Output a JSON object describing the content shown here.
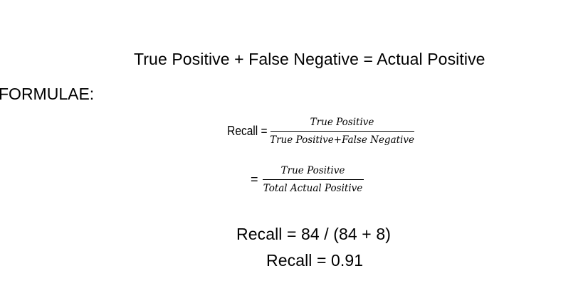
{
  "document": {
    "identity_line": "True Positive + False Negative = Actual Positive",
    "section_label": "FORMULAE:",
    "formula_1": {
      "lhs": "Recall =",
      "numerator": "True Positive",
      "denominator": "True Positive+False Negative"
    },
    "formula_2": {
      "lhs": "=",
      "numerator": "True Positive",
      "denominator": "Total Actual Positive"
    },
    "calculation": {
      "line_1": "Recall = 84 / (84 + 8)",
      "line_2": "Recall = 0.91"
    }
  }
}
